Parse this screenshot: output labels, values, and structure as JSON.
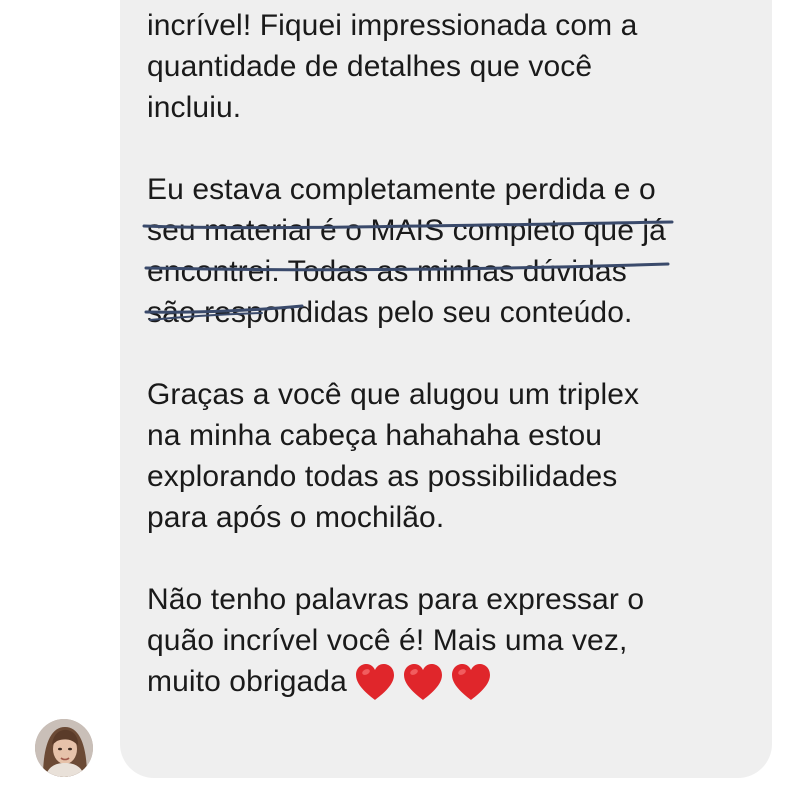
{
  "conversation": {
    "message": {
      "paragraphs": [
        {
          "lines": [
            "incrível! Fiquei impressionada com a",
            "quantidade de detalhes que você",
            "incluiu."
          ]
        },
        {
          "lines": [
            "Eu estava completamente perdida e o",
            "seu material é o MAIS completo que já",
            "encontrei. Todas as minhas dúvidas",
            "são respondidas pelo seu conteúdo."
          ]
        },
        {
          "lines": [
            "Graças a você que alugou um triplex",
            "na minha cabeça hahahaha estou",
            "explorando todas as possibilidades",
            "para após o mochilão."
          ]
        },
        {
          "lines": [
            "Não tenho palavras para expressar o",
            "quão incrível você é! Mais uma vez,",
            "muito obrigada"
          ]
        }
      ],
      "emoji": [
        "red-heart",
        "red-heart",
        "red-heart"
      ]
    },
    "sender": {
      "avatar_icon": "profile-photo"
    },
    "colors": {
      "bubble_background": "#efefef",
      "text": "#1a1a1a",
      "underline_ink": "#3a4a6b",
      "heart": "#e0262b"
    }
  }
}
